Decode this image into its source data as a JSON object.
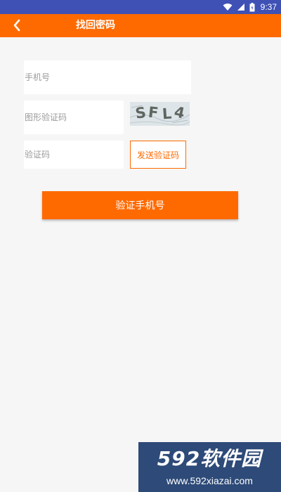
{
  "status_bar": {
    "time": "9:37",
    "icons": [
      "wifi-icon",
      "signal-icon",
      "battery-icon"
    ],
    "color": "#3f51b5"
  },
  "header": {
    "title": "找回密码",
    "back_icon": "chevron-left-icon",
    "color": "#ff6a00"
  },
  "form": {
    "phone_placeholder": "手机号",
    "captcha_placeholder": "图形验证码",
    "captcha_image_text": "SFL4",
    "code_placeholder": "验证码",
    "send_code_label": "发送验证码",
    "submit_label": "验证手机号"
  },
  "watermark": {
    "brand": "592软件园",
    "url": "www.592xiazai.com"
  }
}
